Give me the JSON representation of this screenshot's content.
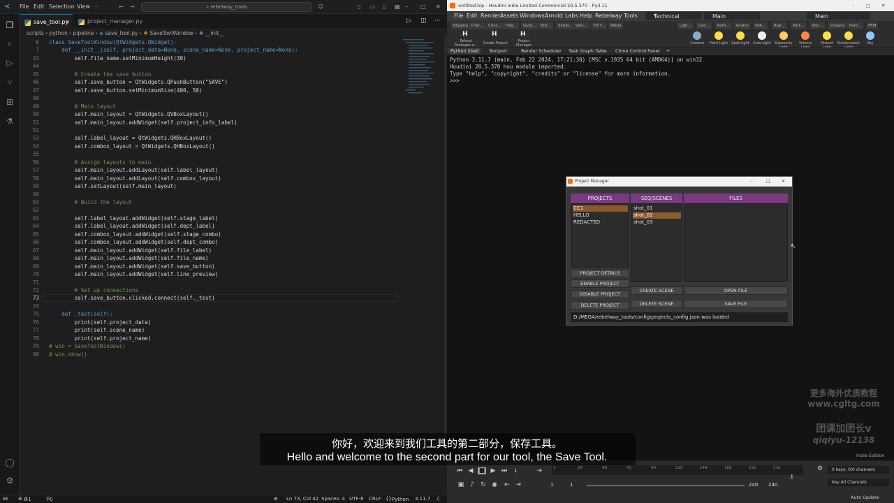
{
  "vscode": {
    "menu": [
      "File",
      "Edit",
      "Selection",
      "View"
    ],
    "search": "rebelway_tools",
    "tabs": [
      {
        "label": "save_tool.py",
        "active": true
      },
      {
        "label": "project_manager.py",
        "active": false
      }
    ],
    "breadcrumb": [
      "scripts",
      "python",
      "pipeline",
      "save_tool.py",
      "SaveToolWindow",
      "__init__"
    ],
    "code": [
      {
        "n": "6",
        "t": "class SaveToolWindow(QtWidgets.QWidget):"
      },
      {
        "n": "7",
        "t": "    def __init__(self, project_data=None, scene_name=None, project_name=None):"
      },
      {
        "n": "43",
        "t": "        self.file_name.setMinimumHeight(30)"
      },
      {
        "n": "44",
        "t": ""
      },
      {
        "n": "45",
        "t": "        # Create the save button"
      },
      {
        "n": "46",
        "t": "        self.save_button = QtWidgets.QPushButton(\"SAVE\")"
      },
      {
        "n": "47",
        "t": "        self.save_button.setMinimumSize(400, 50)"
      },
      {
        "n": "48",
        "t": ""
      },
      {
        "n": "49",
        "t": "        # Main layout"
      },
      {
        "n": "50",
        "t": "        self.main_layout = QtWidgets.QVBoxLayout()"
      },
      {
        "n": "51",
        "t": "        self.main_layout.addWidget(self.project_info_label)"
      },
      {
        "n": "52",
        "t": ""
      },
      {
        "n": "53",
        "t": "        self.label_layout = QtWidgets.QHBoxLayout()"
      },
      {
        "n": "54",
        "t": "        self.combox_layout = QtWidgets.QHBoxLayout()"
      },
      {
        "n": "55",
        "t": ""
      },
      {
        "n": "56",
        "t": "        # Assign layouts to main"
      },
      {
        "n": "57",
        "t": "        self.main_layout.addLayout(self.label_layout)"
      },
      {
        "n": "58",
        "t": "        self.main_layout.addLayout(self.combox_layout)"
      },
      {
        "n": "59",
        "t": "        self.setLayout(self.main_layout)"
      },
      {
        "n": "60",
        "t": ""
      },
      {
        "n": "61",
        "t": "        # Build the layout"
      },
      {
        "n": "62",
        "t": ""
      },
      {
        "n": "63",
        "t": "        self.label_layout.addWidget(self.stage_label)"
      },
      {
        "n": "64",
        "t": "        self.label_layout.addWidget(self.dept_label)"
      },
      {
        "n": "65",
        "t": "        self.combox_layout.addWidget(self.stage_combo)"
      },
      {
        "n": "66",
        "t": "        self.combox_layout.addWidget(self.dept_combo)"
      },
      {
        "n": "67",
        "t": "        self.main_layout.addWidget(self.file_label)"
      },
      {
        "n": "68",
        "t": "        self.main_layout.addWidget(self.file_name)"
      },
      {
        "n": "69",
        "t": "        self.main_layout.addWidget(self.save_button)"
      },
      {
        "n": "70",
        "t": "        self.main_layout.addWidget(self.line_preview)"
      },
      {
        "n": "71",
        "t": ""
      },
      {
        "n": "72",
        "t": "        # Set up connections"
      },
      {
        "n": "73",
        "t": "        self.save_button.clicked.connect(self._test)"
      },
      {
        "n": "74",
        "t": ""
      },
      {
        "n": "75",
        "t": "    def _test(self):"
      },
      {
        "n": "76",
        "t": "        print(self.project_data)"
      },
      {
        "n": "77",
        "t": "        print(self.scene_name)"
      },
      {
        "n": "78",
        "t": "        print(self.project_name)"
      },
      {
        "n": "79",
        "t": "# win = SaveToolWindow()"
      },
      {
        "n": "80",
        "t": "# win.show()"
      }
    ],
    "status": {
      "errors": "0",
      "warnings": "1",
      "ports": "0",
      "position": "Ln 73, Col 42",
      "spaces": "Spaces: 4",
      "encoding": "UTF-8",
      "eol": "CRLF",
      "language": "Python",
      "version": "3.11.7"
    }
  },
  "houdini": {
    "title": "untitled.hip - Houdini Indie Limited-Commercial 20.5.370 - Py3.11",
    "menu": [
      "File",
      "Edit",
      "Render",
      "Assets",
      "Windows",
      "Arnold",
      "Labs",
      "Help",
      "Rebelway Tools"
    ],
    "desktop": "Technical",
    "context": "Main",
    "context2": "Main",
    "shelf_tabs_left": [
      "Rigging",
      "Char...",
      "Cons...",
      "Hair...",
      "Guid...",
      "Terr...",
      "Simpl...",
      "Volu...",
      "TD T...",
      "Rebel"
    ],
    "shelf_tools_left": [
      "Reload Packages a...",
      "Create Project",
      "Project Manager"
    ],
    "shelf_tabs_right": [
      "Ligh...",
      "Coll...",
      "Parti...",
      "Grains",
      "Vell...",
      "Rigi...",
      "Part...",
      "Visc...",
      "Oceans",
      "Pyro...",
      "FEM"
    ],
    "shelf_tools_right": [
      "Camera",
      "Point Light",
      "Spot Light",
      "Area Light",
      "Geometry Light",
      "Volume Light",
      "Distant Light",
      "Environment Light",
      "Sky"
    ],
    "pane_tabs": [
      "Python Shell",
      "Textport",
      "Render Scheduler",
      "Task Graph Table",
      "Clone Control Panel"
    ],
    "console": [
      "Python 3.11.7 (main, Feb 22 2024, 17:21:30) [MSC v.1935 64 bit (AMD64)] on win32",
      "Houdini 20.5.370 hou module imported.",
      "Type \"help\", \"copyright\", \"credits\" or \"license\" for more information.",
      ">>>"
    ],
    "watermark": [
      "更多海外优质教程",
      "www.cgltg.com",
      "团课加团长v",
      "qiqiyu-12138"
    ],
    "indie": "Indie Edition",
    "timeline": {
      "frame": "1",
      "start": "1",
      "start2": "1",
      "end": "240",
      "end2": "240",
      "ticks": [
        "1",
        "24",
        "48",
        "72",
        "96",
        "120",
        "144",
        "168",
        "192",
        "216"
      ],
      "keys": "0 keys, 0/0 channels",
      "key_all": "Key All Channels",
      "auto_update": "Auto Update"
    }
  },
  "project_manager": {
    "title": "Project Manager",
    "headers": [
      "PROJECTS",
      "SEQ/SCENES",
      "FILES"
    ],
    "projects": [
      {
        "label": "CC1",
        "selected": true
      },
      {
        "label": "HELLO",
        "selected": false
      },
      {
        "label": "REDACTED",
        "selected": false
      }
    ],
    "scenes": [
      {
        "label": "shot_01",
        "selected": false
      },
      {
        "label": "shot_02",
        "selected": true
      },
      {
        "label": "shot_03",
        "selected": false
      }
    ],
    "buttons": {
      "project_details": "PROJECT DETAILS",
      "enable_project": "ENABLE PROJECT",
      "disable_project": "DISABLE PROJECT",
      "delete_project": "DELETE PROJECT",
      "create_scene": "CREATE SCENE",
      "delete_scene": "DELETE SCENE",
      "open_file": "OPEN FILE",
      "save_file": "SAVE FILE"
    },
    "status": "D:/MEGA/rebelway_tools/config\\projects_config.json was loaded"
  },
  "subtitles": {
    "cn": "你好，欢迎来到我们工具的第二部分，保存工具。",
    "en": "Hello and welcome to the second part for our tool, the Save Tool."
  }
}
